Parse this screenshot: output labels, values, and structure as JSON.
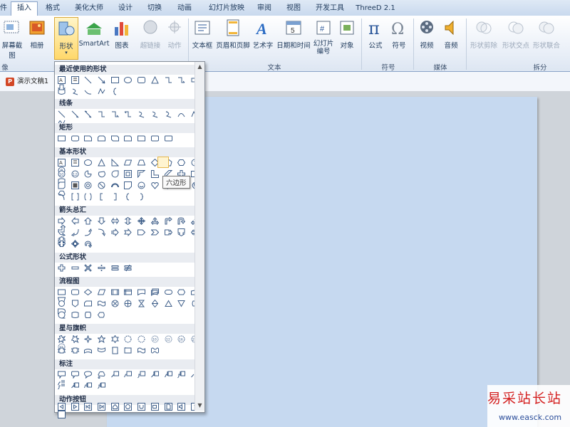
{
  "tabs": [
    {
      "label": "件"
    },
    {
      "label": "插入"
    },
    {
      "label": "格式"
    },
    {
      "label": "美化大师"
    },
    {
      "label": "设计"
    },
    {
      "label": "切换"
    },
    {
      "label": "动画"
    },
    {
      "label": "幻灯片放映"
    },
    {
      "label": "审阅"
    },
    {
      "label": "视图"
    },
    {
      "label": "开发工具"
    },
    {
      "label": "ThreeD 2.1"
    }
  ],
  "ribbon": {
    "buttons": [
      {
        "label": "屏幕截图"
      },
      {
        "label": "相册"
      },
      {
        "label": "形状"
      },
      {
        "label": "SmartArt"
      },
      {
        "label": "图表"
      },
      {
        "label": "超链接"
      },
      {
        "label": "动作"
      },
      {
        "label": "文本框"
      },
      {
        "label": "页眉和页脚"
      },
      {
        "label": "艺术字"
      },
      {
        "label": "日期和时间"
      },
      {
        "label": "幻灯片编号"
      },
      {
        "label": "对象"
      },
      {
        "label": "公式"
      },
      {
        "label": "符号"
      },
      {
        "label": "视频"
      },
      {
        "label": "音频"
      },
      {
        "label": "形状剪除"
      },
      {
        "label": "形状交点"
      },
      {
        "label": "形状联合"
      }
    ],
    "groups": [
      {
        "label": "像"
      },
      {
        "label": "文本"
      },
      {
        "label": "符号"
      },
      {
        "label": "媒体"
      },
      {
        "label": "拆分"
      }
    ]
  },
  "document": {
    "tab_label": "演示文稿1"
  },
  "shapes_gallery": {
    "sections": [
      {
        "title": "最近使用的形状"
      },
      {
        "title": "线条"
      },
      {
        "title": "矩形"
      },
      {
        "title": "基本形状"
      },
      {
        "title": "箭头总汇"
      },
      {
        "title": "公式形状"
      },
      {
        "title": "流程图"
      },
      {
        "title": "星与旗帜"
      },
      {
        "title": "标注"
      },
      {
        "title": "动作按钮"
      }
    ],
    "tooltip": "六边形"
  },
  "watermark": {
    "line1": "易采站长站",
    "line2": "www.easck.com"
  },
  "colors": {
    "accent": "#2b579a",
    "slide": "#c6d9f0",
    "selected": "#ffd86b"
  }
}
